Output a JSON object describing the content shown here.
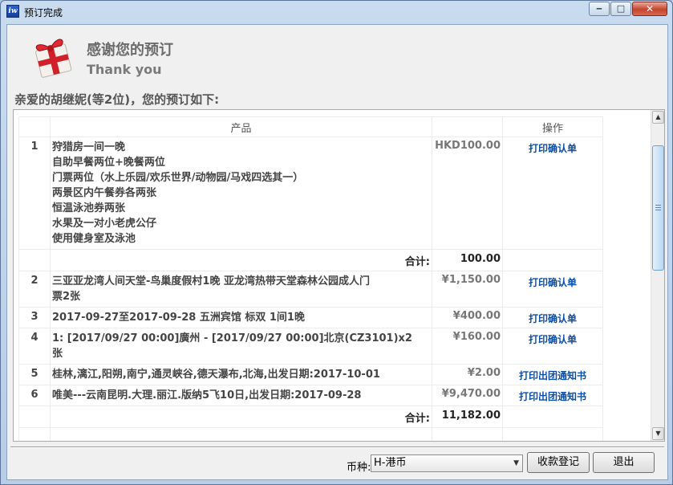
{
  "window": {
    "title": "预订完成"
  },
  "header": {
    "title_cn": "感谢您的预订",
    "title_en": "Thank you"
  },
  "greeting": "亲爱的胡继妮(等2位)，您的预订如下:",
  "table": {
    "columns": {
      "product": "产品",
      "action": "操作"
    },
    "rows": [
      {
        "no": "1",
        "lines": [
          "狩猎房一间一晚",
          "自助早餐两位+晚餐两位",
          "门票两位（水上乐园/欢乐世界/动物园/马戏四选其一）",
          "两景区内午餐券各两张",
          "恒温泳池券两张",
          "水果及一对小老虎公仔",
          "使用健身室及泳池"
        ],
        "price": "HKD100.00",
        "action": "打印确认单"
      },
      {
        "no": "2",
        "lines": [
          "三亚亚龙湾人间天堂-鸟巢度假村1晚 亚龙湾热带天堂森林公园成人门",
          "票2张"
        ],
        "price": "¥1,150.00",
        "action": "打印确认单"
      },
      {
        "no": "3",
        "lines": [
          "2017-09-27至2017-09-28 五洲宾馆 标双 1间1晚"
        ],
        "price": "¥400.00",
        "action": "打印确认单"
      },
      {
        "no": "4",
        "lines": [
          "1: [2017/09/27 00:00]廣州 - [2017/09/27 00:00]北京(CZ3101)x2",
          "张"
        ],
        "price": "¥160.00",
        "action": "打印确认单"
      },
      {
        "no": "5",
        "lines": [
          "桂林,漓江,阳朔,南宁,通灵峡谷,德天瀑布,北海,出发日期:2017-10-01"
        ],
        "price": "¥2.00",
        "action": "打印出团通知书"
      },
      {
        "no": "6",
        "lines": [
          "唯美---云南昆明.大理.丽江.版纳5飞10日,出发日期:2017-09-28"
        ],
        "price": "¥9,470.00",
        "action": "打印出团通知书"
      }
    ],
    "subtotal": {
      "label": "合计:",
      "value": "100.00"
    },
    "total": {
      "label": "合计:",
      "value": "11,182.00"
    }
  },
  "footer": {
    "currency_label": "币种:",
    "currency_value": "H-港币",
    "register_button": "收款登记",
    "exit_button": "退出"
  },
  "colors": {
    "title_bar": "#c9dbef",
    "link": "#0a4ea7",
    "close_button": "#c6432b"
  },
  "icons": [
    "app-icon",
    "gift-icon",
    "minimize-icon",
    "maximize-icon",
    "close-icon",
    "dropdown-arrow-icon",
    "scroll-up-icon",
    "scroll-down-icon"
  ]
}
